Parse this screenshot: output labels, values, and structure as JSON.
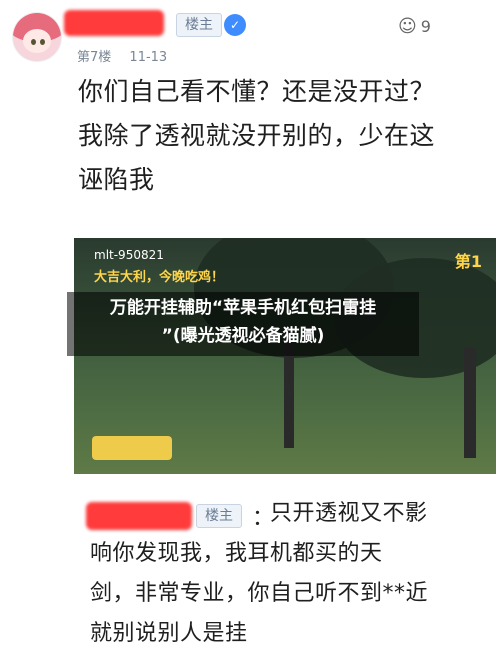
{
  "comment1": {
    "badge": "楼主",
    "floor": "第7楼",
    "date": "11-13",
    "likes": "9",
    "lines": [
      "你们自己看不懂？还是没开过？",
      "我除了透视就没开别的，少在这",
      "诬陷我"
    ]
  },
  "screenshot": {
    "id_text": "mlt-950821",
    "subtitle": "大吉大利，今晚吃鸡！",
    "corner": "第1"
  },
  "overlay": {
    "line1": "万能开挂辅助“苹果手机红包扫雷挂",
    "line2": "”(曝光透视必备猫腻)"
  },
  "comment2": {
    "badge": "楼主",
    "colon": "：",
    "lines": [
      "只开透视又不影",
      "响你发现我，我耳机都买的天",
      "剑，非常专业，你自己听不到**近",
      "就别说别人是挂"
    ]
  }
}
